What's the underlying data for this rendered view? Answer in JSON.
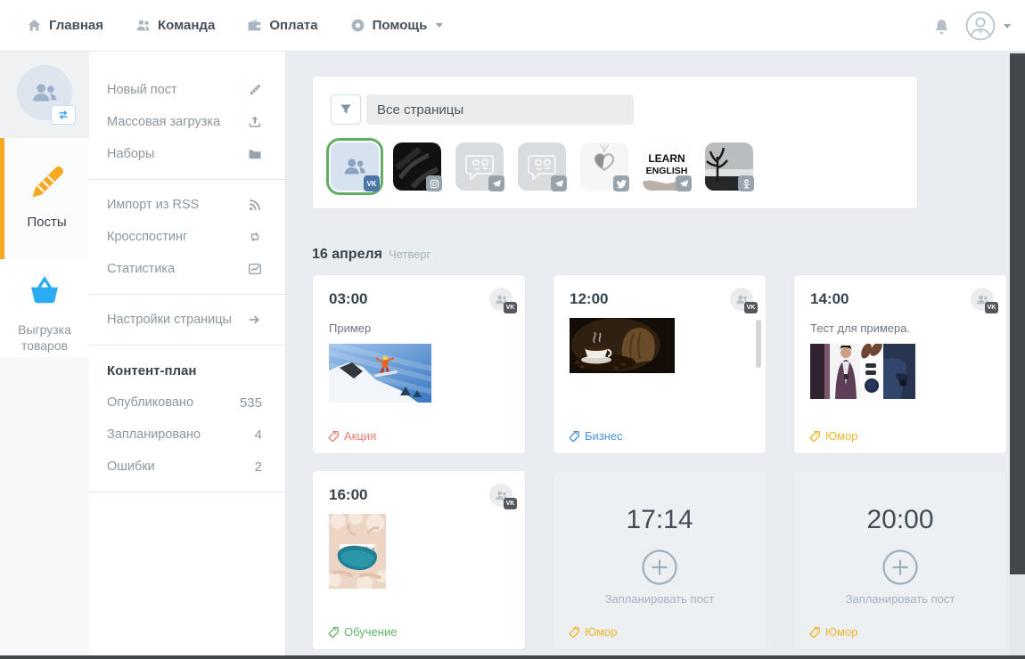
{
  "topnav": {
    "items": [
      {
        "id": "home",
        "label": "Главная",
        "icon": "home"
      },
      {
        "id": "team",
        "label": "Команда",
        "icon": "team"
      },
      {
        "id": "payment",
        "label": "Оплата",
        "icon": "wallet"
      },
      {
        "id": "help",
        "label": "Помощь",
        "icon": "lifebuoy",
        "dropdown": true
      }
    ]
  },
  "rail": {
    "items": [
      {
        "id": "posts",
        "label": "Посты",
        "icon": "pencil",
        "active": true,
        "accent": "#f7a823"
      },
      {
        "id": "goods-export",
        "label": "Выгрузка товаров",
        "icon": "basket",
        "active": false,
        "accent": "#2aabf2"
      }
    ]
  },
  "sidebar": {
    "groups": [
      {
        "items": [
          {
            "label": "Новый пост",
            "icon": "pencil-sm"
          },
          {
            "label": "Массовая загрузка",
            "icon": "upload"
          },
          {
            "label": "Наборы",
            "icon": "folder"
          }
        ]
      },
      {
        "items": [
          {
            "label": "Импорт из RSS",
            "icon": "rss"
          },
          {
            "label": "Кросспостинг",
            "icon": "repost"
          },
          {
            "label": "Статистика",
            "icon": "stats"
          }
        ]
      },
      {
        "items": [
          {
            "label": "Настройки страницы",
            "icon": "arrow-right"
          }
        ]
      }
    ],
    "content_plan": {
      "title": "Контент-план",
      "rows": [
        {
          "label": "Опубликовано",
          "value": "535"
        },
        {
          "label": "Запланировано",
          "value": "4"
        },
        {
          "label": "Ошибки",
          "value": "2"
        }
      ]
    }
  },
  "filter": {
    "input_value": "Все страницы",
    "pages": [
      {
        "network": "vk",
        "thumb": "vk-avatar",
        "selected": true
      },
      {
        "network": "instagram",
        "thumb": "dark-photo",
        "selected": false
      },
      {
        "network": "telegram",
        "thumb": "placeholder",
        "selected": false
      },
      {
        "network": "telegram",
        "thumb": "placeholder",
        "selected": false
      },
      {
        "network": "twitter",
        "thumb": "pendant",
        "selected": false
      },
      {
        "network": "telegram",
        "thumb": "learn-english",
        "selected": false
      },
      {
        "network": "odnoklassniki",
        "thumb": "tree-photo",
        "selected": false
      }
    ]
  },
  "schedule": {
    "date": "16 апреля",
    "weekday": "Четверг",
    "cards": [
      {
        "time": "03:00",
        "type": "post",
        "network": "vk",
        "text": "Пример",
        "image": "snowboard",
        "tag": {
          "label": "Акция",
          "color": "#e87b6b"
        }
      },
      {
        "time": "12:00",
        "type": "post",
        "network": "vk",
        "text": "",
        "image": "coffee",
        "tag": {
          "label": "Бизнес",
          "color": "#4a90d9"
        },
        "has_scrollbar": true
      },
      {
        "time": "14:00",
        "type": "post",
        "network": "vk",
        "text": "Тест для примера.",
        "image": "fashion",
        "tag": {
          "label": "Юмор",
          "color": "#f0b429"
        }
      },
      {
        "time": "16:00",
        "type": "post",
        "network": "vk",
        "text": "",
        "image": "lagoon",
        "tag": {
          "label": "Обучение",
          "color": "#62b766"
        }
      },
      {
        "time": "17:14",
        "type": "slot",
        "action_label": "Запланировать пост",
        "tag": {
          "label": "Юмор",
          "color": "#f0b429"
        }
      },
      {
        "time": "20:00",
        "type": "slot",
        "action_label": "Запланировать пост",
        "tag": {
          "label": "Юмор",
          "color": "#f0b429"
        }
      }
    ]
  },
  "colors": {
    "accent_orange": "#f7a823",
    "accent_blue": "#2aabf2",
    "selected_green": "#61ad63",
    "vk_blue": "#4a76a8",
    "network_gray": "#99a3ab",
    "scrollbar_dark": "#43474b"
  }
}
